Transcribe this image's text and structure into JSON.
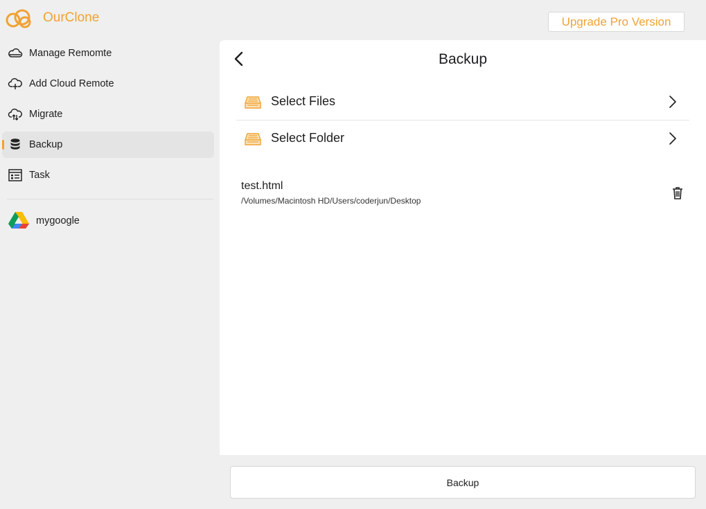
{
  "app": {
    "title": "OurClone",
    "accent_color": "#f0a233",
    "logo_icon": "ourclone-logo-icon"
  },
  "header": {
    "upgrade_label": "Upgrade Pro Version"
  },
  "sidebar": {
    "items": [
      {
        "label": "Manage Remomte",
        "icon": "cloud-icon"
      },
      {
        "label": "Add Cloud Remote",
        "icon": "cloud-add-icon"
      },
      {
        "label": "Migrate",
        "icon": "cloud-sync-icon"
      },
      {
        "label": "Backup",
        "icon": "database-icon",
        "active": true
      },
      {
        "label": "Task",
        "icon": "task-list-icon"
      }
    ],
    "remotes": [
      {
        "label": "mygoogle",
        "icon": "google-drive-icon"
      }
    ]
  },
  "main": {
    "title": "Backup",
    "options": [
      {
        "label": "Select Files",
        "icon": "drive-icon"
      },
      {
        "label": "Select Folder",
        "icon": "drive-icon"
      }
    ],
    "files": [
      {
        "name": "test.html",
        "path": "/Volumes/Macintosh HD/Users/coderjun/Desktop"
      }
    ]
  },
  "footer": {
    "backup_button_label": "Backup"
  }
}
